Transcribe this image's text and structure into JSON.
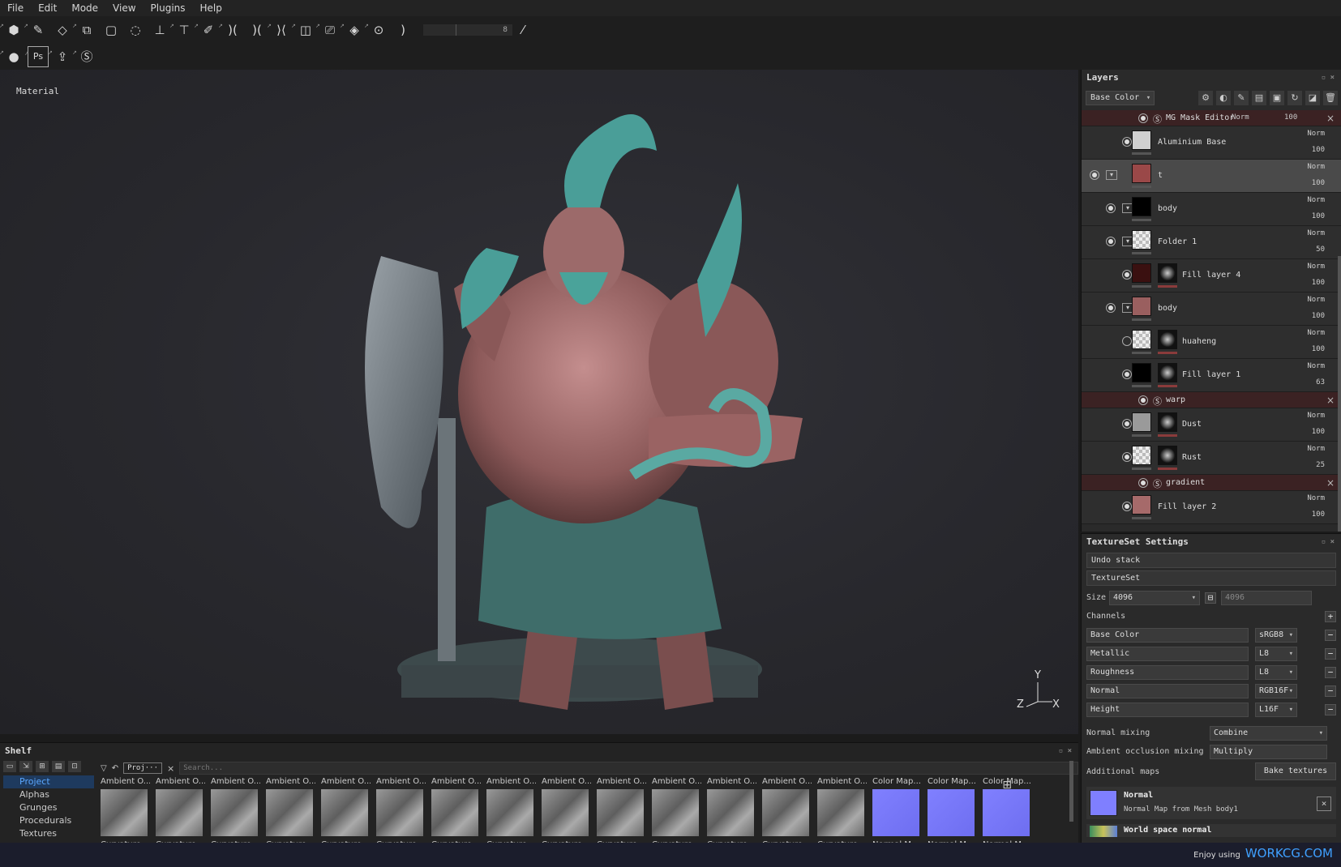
{
  "menu": [
    "File",
    "Edit",
    "Mode",
    "View",
    "Plugins",
    "Help"
  ],
  "toolbar": {
    "slider_value": "8"
  },
  "toolbar2": {
    "ps_label": "Ps"
  },
  "viewport": {
    "label": "Material",
    "axes": {
      "y": "Y",
      "z": "Z",
      "x": "X"
    }
  },
  "layers": {
    "title": "Layers",
    "channel": "Base Color",
    "rows": [
      {
        "kind": "effect",
        "name": "MG Mask Editor",
        "blend": "Norm",
        "opacity": "100"
      },
      {
        "kind": "layer",
        "name": "Aluminium Base",
        "blend": "Norm",
        "opacity": "100",
        "thumb": "#d0d0d0",
        "eye": true
      },
      {
        "kind": "folder",
        "name": "t",
        "blend": "Norm",
        "opacity": "100",
        "thumb": "#9a4848",
        "eye": true,
        "selected": true
      },
      {
        "kind": "folder",
        "name": "body",
        "blend": "Norm",
        "opacity": "100",
        "thumb": "#000000",
        "eye": true
      },
      {
        "kind": "folder",
        "name": "Folder 1",
        "blend": "Norm",
        "opacity": "50",
        "thumb": "checker",
        "eye": true
      },
      {
        "kind": "layer",
        "name": "Fill layer 4",
        "blend": "Norm",
        "opacity": "100",
        "thumb": "#3a1010",
        "mask": true,
        "eye": true
      },
      {
        "kind": "folder",
        "name": "body",
        "blend": "Norm",
        "opacity": "100",
        "thumb": "#9a5f5f",
        "eye": true
      },
      {
        "kind": "layer",
        "name": "huaheng",
        "blend": "Norm",
        "opacity": "100",
        "thumb": "checker",
        "mask": true,
        "eye": false
      },
      {
        "kind": "layer",
        "name": "Fill layer 1",
        "blend": "Norm",
        "opacity": "63",
        "thumb": "#000000",
        "mask": true,
        "eye": true
      },
      {
        "kind": "effect",
        "name": "warp"
      },
      {
        "kind": "layer",
        "name": "Dust",
        "blend": "Norm",
        "opacity": "100",
        "thumb": "#9a9a9a",
        "mask": true,
        "eye": true
      },
      {
        "kind": "layer",
        "name": "Rust",
        "blend": "Norm",
        "opacity": "25",
        "thumb": "checker",
        "mask": true,
        "eye": true
      },
      {
        "kind": "effect",
        "name": "gradient"
      },
      {
        "kind": "layer",
        "name": "Fill layer 2",
        "blend": "Norm",
        "opacity": "100",
        "thumb": "#a66a6a",
        "eye": true
      }
    ]
  },
  "texset": {
    "title": "TextureSet Settings",
    "undo": "Undo stack",
    "name": "TextureSet",
    "size_label": "Size",
    "size_w": "4096",
    "size_h": "4096",
    "channels_label": "Channels",
    "channels": [
      {
        "name": "Base Color",
        "format": "sRGB8"
      },
      {
        "name": "Metallic",
        "format": "L8"
      },
      {
        "name": "Roughness",
        "format": "L8"
      },
      {
        "name": "Normal",
        "format": "RGB16F"
      },
      {
        "name": "Height",
        "format": "L16F"
      }
    ],
    "normal_mixing_label": "Normal mixing",
    "normal_mixing": "Combine",
    "ao_mixing_label": "Ambient occlusion mixing",
    "ao_mixing": "Multiply",
    "additional_label": "Additional maps",
    "bake_label": "Bake textures",
    "normal_title": "Normal",
    "normal_sub": "Normal Map from Mesh body1",
    "world_normal": "World space normal"
  },
  "shelf": {
    "title": "Shelf",
    "categories": [
      "Project",
      "Alphas",
      "Grunges",
      "Procedurals",
      "Textures"
    ],
    "filter_chip": "Proj···",
    "search_placeholder": "Search...",
    "tiles": [
      {
        "top": "Ambient O...",
        "bottom": "Curvature ..."
      },
      {
        "top": "Ambient O...",
        "bottom": "Curvature ..."
      },
      {
        "top": "Ambient O...",
        "bottom": "Curvature ..."
      },
      {
        "top": "Ambient O...",
        "bottom": "Curvature ..."
      },
      {
        "top": "Ambient O...",
        "bottom": "Curvature ..."
      },
      {
        "top": "Ambient O...",
        "bottom": "Curvature ..."
      },
      {
        "top": "Ambient O...",
        "bottom": "Curvature ..."
      },
      {
        "top": "Ambient O...",
        "bottom": "Curvature ..."
      },
      {
        "top": "Ambient O...",
        "bottom": "Curvature ..."
      },
      {
        "top": "Ambient O...",
        "bottom": "Curvature ..."
      },
      {
        "top": "Ambient O...",
        "bottom": "Curvature ..."
      },
      {
        "top": "Ambient O...",
        "bottom": "Curvature ..."
      },
      {
        "top": "Ambient O...",
        "bottom": "Curvature ..."
      },
      {
        "top": "Ambient O...",
        "bottom": "Curvature ..."
      },
      {
        "top": "Color Map...",
        "bottom": "Normal M...",
        "normal": true
      },
      {
        "top": "Color Map...",
        "bottom": "Normal M...",
        "normal": true
      },
      {
        "top": "Color Map...",
        "bottom": "Normal M...",
        "normal": true
      }
    ]
  },
  "watermark": {
    "prefix": "Enjoy using",
    "brand": "WORKCG.COM"
  }
}
